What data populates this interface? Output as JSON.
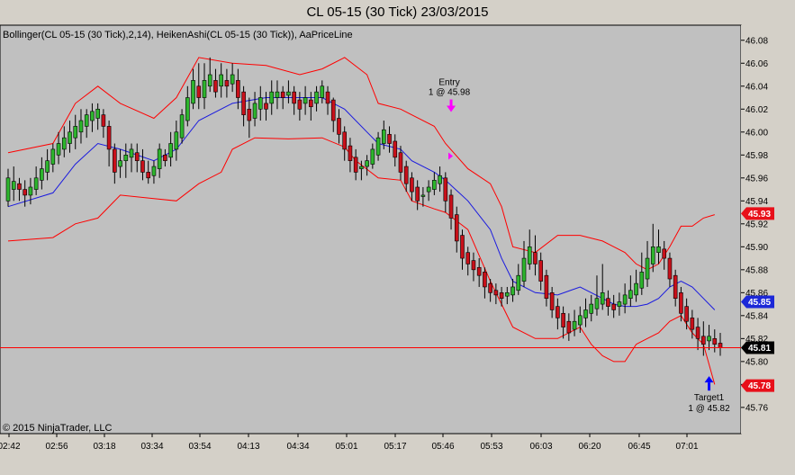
{
  "window": {
    "title": "CL 05-15 (30 Tick)  23/03/2015"
  },
  "indicator_label": "Bollinger(CL 05-15 (30 Tick),2,14), HeikenAshi(CL 05-15 (30 Tick)), AaPriceLine",
  "copyright": "© 2015 NinjaTrader, LLC",
  "colors": {
    "background": "#c0c0c0",
    "frame": "#d4d0c8",
    "bull": "#2db52d",
    "bear": "#c8101a",
    "wick": "#000000",
    "bollinger_band": "#ff0000",
    "bollinger_mid": "#1a1adf",
    "price_line": "#ff0000",
    "entry_arrow": "#ff00ff",
    "target_arrow": "#0000ff",
    "tag_red": "#e8101a",
    "tag_blue": "#1c28d8",
    "tag_black": "#000000"
  },
  "chart_data": {
    "type": "candlestick",
    "ylim": [
      45.745,
      46.09
    ],
    "y_ticks": [
      "46.08",
      "46.06",
      "46.04",
      "46.02",
      "46.00",
      "45.98",
      "45.96",
      "45.94",
      "45.92",
      "45.90",
      "45.88",
      "45.86",
      "45.84",
      "45.82",
      "45.80",
      "45.78",
      "45.76"
    ],
    "x_ticks": [
      "02:42",
      "02:56",
      "03:18",
      "03:34",
      "03:54",
      "04:13",
      "04:34",
      "05:01",
      "05:17",
      "05:46",
      "05:53",
      "06:03",
      "06:20",
      "06:45",
      "07:01"
    ],
    "candles": [
      [
        45.94,
        45.96,
        45.935,
        45.968,
        "u"
      ],
      [
        45.95,
        45.957,
        45.94,
        45.97,
        "u"
      ],
      [
        45.955,
        45.95,
        45.94,
        45.96,
        "d"
      ],
      [
        45.95,
        45.945,
        45.935,
        45.958,
        "d"
      ],
      [
        45.945,
        45.952,
        45.937,
        45.96,
        "u"
      ],
      [
        45.95,
        45.96,
        45.945,
        45.97,
        "u"
      ],
      [
        45.958,
        45.968,
        45.95,
        45.978,
        "u"
      ],
      [
        45.965,
        45.975,
        45.958,
        45.985,
        "u"
      ],
      [
        45.972,
        45.985,
        45.965,
        45.99,
        "u"
      ],
      [
        45.98,
        45.99,
        45.972,
        46.0,
        "u"
      ],
      [
        45.985,
        45.995,
        45.978,
        46.005,
        "u"
      ],
      [
        45.99,
        46.0,
        45.982,
        46.01,
        "u"
      ],
      [
        45.995,
        46.005,
        45.985,
        46.015,
        "u"
      ],
      [
        46.0,
        46.01,
        45.99,
        46.02,
        "u"
      ],
      [
        46.005,
        46.015,
        45.995,
        46.02,
        "u"
      ],
      [
        46.01,
        46.018,
        46.0,
        46.025,
        "u"
      ],
      [
        46.012,
        46.02,
        46.002,
        46.025,
        "u"
      ],
      [
        46.015,
        46.005,
        45.995,
        46.02,
        "d"
      ],
      [
        46.005,
        45.985,
        45.97,
        46.01,
        "d"
      ],
      [
        45.985,
        45.965,
        45.955,
        45.99,
        "d"
      ],
      [
        45.97,
        45.975,
        45.96,
        45.985,
        "u"
      ],
      [
        45.975,
        45.98,
        45.96,
        45.99,
        "u"
      ],
      [
        45.978,
        45.985,
        45.965,
        45.99,
        "u"
      ],
      [
        45.982,
        45.975,
        45.965,
        45.99,
        "d"
      ],
      [
        45.975,
        45.965,
        45.958,
        45.985,
        "d"
      ],
      [
        45.965,
        45.96,
        45.955,
        45.975,
        "d"
      ],
      [
        45.962,
        45.97,
        45.955,
        45.975,
        "u"
      ],
      [
        45.968,
        45.985,
        45.96,
        45.99,
        "u"
      ],
      [
        45.98,
        45.975,
        45.97,
        45.985,
        "d"
      ],
      [
        45.978,
        45.99,
        45.97,
        46.0,
        "u"
      ],
      [
        45.985,
        46.0,
        45.975,
        46.01,
        "u"
      ],
      [
        45.995,
        46.015,
        45.99,
        46.02,
        "u"
      ],
      [
        46.01,
        46.03,
        46.005,
        46.04,
        "u"
      ],
      [
        46.025,
        46.045,
        46.02,
        46.055,
        "u"
      ],
      [
        46.04,
        46.03,
        46.02,
        46.06,
        "d"
      ],
      [
        46.03,
        46.045,
        46.02,
        46.06,
        "u"
      ],
      [
        46.04,
        46.05,
        46.035,
        46.065,
        "u"
      ],
      [
        46.045,
        46.035,
        46.03,
        46.055,
        "d"
      ],
      [
        46.04,
        46.05,
        46.03,
        46.06,
        "u"
      ],
      [
        46.045,
        46.04,
        46.03,
        46.055,
        "d"
      ],
      [
        46.042,
        46.05,
        46.035,
        46.06,
        "u"
      ],
      [
        46.045,
        46.03,
        46.02,
        46.055,
        "d"
      ],
      [
        46.035,
        46.015,
        46.005,
        46.04,
        "d"
      ],
      [
        46.02,
        46.01,
        45.995,
        46.03,
        "d"
      ],
      [
        46.012,
        46.025,
        46.005,
        46.035,
        "u"
      ],
      [
        46.02,
        46.03,
        46.01,
        46.04,
        "u"
      ],
      [
        46.025,
        46.02,
        46.01,
        46.035,
        "d"
      ],
      [
        46.025,
        46.035,
        46.015,
        46.045,
        "u"
      ],
      [
        46.03,
        46.035,
        46.02,
        46.045,
        "u"
      ],
      [
        46.035,
        46.03,
        46.02,
        46.04,
        "d"
      ],
      [
        46.032,
        46.035,
        46.025,
        46.045,
        "u"
      ],
      [
        46.035,
        46.025,
        46.015,
        46.04,
        "d"
      ],
      [
        46.028,
        46.02,
        46.01,
        46.035,
        "d"
      ],
      [
        46.025,
        46.03,
        46.015,
        46.04,
        "u"
      ],
      [
        46.028,
        46.022,
        46.01,
        46.035,
        "d"
      ],
      [
        46.025,
        46.035,
        46.018,
        46.04,
        "u"
      ],
      [
        46.03,
        46.04,
        46.025,
        46.045,
        "u"
      ],
      [
        46.035,
        46.025,
        46.015,
        46.04,
        "d"
      ],
      [
        46.028,
        46.01,
        46.0,
        46.03,
        "d"
      ],
      [
        46.012,
        45.998,
        45.99,
        46.02,
        "d"
      ],
      [
        46.0,
        45.985,
        45.975,
        46.005,
        "d"
      ],
      [
        45.988,
        45.975,
        45.965,
        45.995,
        "d"
      ],
      [
        45.978,
        45.965,
        45.958,
        45.985,
        "d"
      ],
      [
        45.968,
        45.97,
        45.958,
        45.975,
        "u"
      ],
      [
        45.97,
        45.975,
        45.962,
        45.98,
        "u"
      ],
      [
        45.972,
        45.985,
        45.968,
        45.99,
        "u"
      ],
      [
        45.98,
        45.995,
        45.975,
        46.0,
        "u"
      ],
      [
        45.99,
        46.002,
        45.985,
        46.01,
        "u"
      ],
      [
        45.998,
        45.99,
        45.982,
        46.005,
        "d"
      ],
      [
        45.992,
        45.978,
        45.97,
        45.998,
        "d"
      ],
      [
        45.982,
        45.965,
        45.958,
        45.988,
        "d"
      ],
      [
        45.97,
        45.955,
        45.948,
        45.975,
        "d"
      ],
      [
        45.96,
        45.948,
        45.94,
        45.965,
        "d"
      ],
      [
        45.952,
        45.94,
        45.932,
        45.958,
        "d"
      ],
      [
        45.945,
        45.945,
        45.935,
        45.952,
        "u"
      ],
      [
        45.948,
        45.952,
        45.94,
        45.958,
        "u"
      ],
      [
        45.95,
        45.958,
        45.945,
        45.965,
        "u"
      ],
      [
        45.955,
        45.962,
        45.948,
        45.97,
        "u"
      ],
      [
        45.96,
        45.94,
        45.93,
        45.965,
        "d"
      ],
      [
        45.945,
        45.925,
        45.915,
        45.95,
        "d"
      ],
      [
        45.928,
        45.905,
        45.895,
        45.935,
        "d"
      ],
      [
        45.91,
        45.89,
        45.88,
        45.915,
        "d"
      ],
      [
        45.895,
        45.885,
        45.875,
        45.9,
        "d"
      ],
      [
        45.888,
        45.88,
        45.87,
        45.895,
        "d"
      ],
      [
        45.882,
        45.875,
        45.865,
        45.89,
        "d"
      ],
      [
        45.878,
        45.865,
        45.855,
        45.882,
        "d"
      ],
      [
        45.868,
        45.86,
        45.852,
        45.872,
        "d"
      ],
      [
        45.862,
        45.858,
        45.85,
        45.868,
        "d"
      ],
      [
        45.86,
        45.855,
        45.848,
        45.865,
        "d"
      ],
      [
        45.857,
        45.86,
        45.85,
        45.865,
        "u"
      ],
      [
        45.858,
        45.865,
        45.852,
        45.872,
        "u"
      ],
      [
        45.862,
        45.875,
        45.858,
        45.885,
        "u"
      ],
      [
        45.87,
        45.89,
        45.865,
        45.905,
        "u"
      ],
      [
        45.885,
        45.9,
        45.88,
        45.915,
        "u"
      ],
      [
        45.895,
        45.885,
        45.875,
        45.91,
        "d"
      ],
      [
        45.888,
        45.87,
        45.862,
        45.895,
        "d"
      ],
      [
        45.875,
        45.855,
        45.848,
        45.88,
        "d"
      ],
      [
        45.86,
        45.845,
        45.838,
        45.865,
        "d"
      ],
      [
        45.848,
        45.838,
        45.828,
        45.855,
        "d"
      ],
      [
        45.842,
        45.83,
        45.82,
        45.848,
        "d"
      ],
      [
        45.835,
        45.825,
        45.818,
        45.842,
        "d"
      ],
      [
        45.828,
        45.835,
        45.822,
        45.845,
        "u"
      ],
      [
        45.832,
        45.84,
        45.825,
        45.848,
        "u"
      ],
      [
        45.838,
        45.845,
        45.83,
        45.855,
        "u"
      ],
      [
        45.842,
        45.85,
        45.835,
        45.858,
        "u"
      ],
      [
        45.846,
        45.855,
        45.84,
        45.875,
        "u"
      ],
      [
        45.85,
        45.86,
        45.845,
        45.885,
        "u"
      ],
      [
        45.855,
        45.848,
        45.84,
        45.862,
        "d"
      ],
      [
        45.85,
        45.845,
        45.838,
        45.858,
        "d"
      ],
      [
        45.848,
        45.852,
        45.84,
        45.86,
        "u"
      ],
      [
        45.85,
        45.858,
        45.842,
        45.868,
        "u"
      ],
      [
        45.855,
        45.862,
        45.848,
        45.875,
        "u"
      ],
      [
        45.858,
        45.868,
        45.852,
        45.88,
        "u"
      ],
      [
        45.864,
        45.878,
        45.858,
        45.895,
        "u"
      ],
      [
        45.872,
        45.89,
        45.865,
        45.905,
        "u"
      ],
      [
        45.885,
        45.9,
        45.878,
        45.92,
        "u"
      ],
      [
        45.895,
        45.9,
        45.885,
        45.915,
        "u"
      ],
      [
        45.898,
        45.89,
        45.88,
        45.905,
        "d"
      ],
      [
        45.89,
        45.872,
        45.865,
        45.895,
        "d"
      ],
      [
        45.875,
        45.855,
        45.848,
        45.88,
        "d"
      ],
      [
        45.86,
        45.842,
        45.835,
        45.865,
        "d"
      ],
      [
        45.848,
        45.835,
        45.828,
        45.855,
        "d"
      ],
      [
        45.838,
        45.828,
        45.82,
        45.845,
        "d"
      ],
      [
        45.83,
        45.82,
        45.81,
        45.838,
        "d"
      ],
      [
        45.822,
        45.815,
        45.805,
        45.835,
        "d"
      ],
      [
        45.818,
        45.822,
        45.81,
        45.832,
        "u"
      ],
      [
        45.82,
        45.815,
        45.808,
        45.828,
        "d"
      ],
      [
        45.816,
        45.812,
        45.805,
        45.825,
        "d"
      ]
    ],
    "bollinger_upper": [
      [
        0,
        45.982
      ],
      [
        8,
        45.99
      ],
      [
        12,
        46.025
      ],
      [
        16,
        46.04
      ],
      [
        20,
        46.025
      ],
      [
        26,
        46.012
      ],
      [
        30,
        46.03
      ],
      [
        34,
        46.065
      ],
      [
        40,
        46.06
      ],
      [
        46,
        46.058
      ],
      [
        52,
        46.05
      ],
      [
        56,
        46.055
      ],
      [
        60,
        46.065
      ],
      [
        64,
        46.05
      ],
      [
        66,
        46.025
      ],
      [
        70,
        46.02
      ],
      [
        72,
        46.015
      ],
      [
        76,
        46.005
      ],
      [
        78,
        45.99
      ],
      [
        82,
        45.968
      ],
      [
        86,
        45.955
      ],
      [
        88,
        45.935
      ],
      [
        90,
        45.9
      ],
      [
        94,
        45.895
      ],
      [
        98,
        45.91
      ],
      [
        102,
        45.91
      ],
      [
        106,
        45.905
      ],
      [
        108,
        45.9
      ],
      [
        110,
        45.895
      ],
      [
        112,
        45.885
      ],
      [
        114,
        45.88
      ],
      [
        116,
        45.885
      ],
      [
        118,
        45.9
      ],
      [
        120,
        45.918
      ],
      [
        122,
        45.918
      ],
      [
        124,
        45.925
      ],
      [
        126,
        45.928
      ]
    ],
    "bollinger_lower": [
      [
        0,
        45.905
      ],
      [
        8,
        45.908
      ],
      [
        12,
        45.92
      ],
      [
        16,
        45.925
      ],
      [
        20,
        45.945
      ],
      [
        26,
        45.942
      ],
      [
        30,
        45.94
      ],
      [
        34,
        45.955
      ],
      [
        38,
        45.965
      ],
      [
        40,
        45.985
      ],
      [
        44,
        45.995
      ],
      [
        50,
        45.994
      ],
      [
        56,
        45.995
      ],
      [
        60,
        45.987
      ],
      [
        62,
        45.975
      ],
      [
        66,
        45.96
      ],
      [
        70,
        45.958
      ],
      [
        72,
        45.94
      ],
      [
        76,
        45.933
      ],
      [
        78,
        45.93
      ],
      [
        82,
        45.915
      ],
      [
        86,
        45.87
      ],
      [
        88,
        45.85
      ],
      [
        90,
        45.83
      ],
      [
        94,
        45.82
      ],
      [
        98,
        45.82
      ],
      [
        102,
        45.83
      ],
      [
        104,
        45.815
      ],
      [
        106,
        45.805
      ],
      [
        108,
        45.8
      ],
      [
        110,
        45.8
      ],
      [
        112,
        45.815
      ],
      [
        114,
        45.82
      ],
      [
        116,
        45.825
      ],
      [
        118,
        45.835
      ],
      [
        120,
        45.84
      ],
      [
        122,
        45.825
      ],
      [
        124,
        45.815
      ],
      [
        126,
        45.78
      ]
    ],
    "bollinger_mid": [
      [
        0,
        45.935
      ],
      [
        8,
        45.947
      ],
      [
        12,
        45.972
      ],
      [
        16,
        45.99
      ],
      [
        20,
        45.985
      ],
      [
        26,
        45.975
      ],
      [
        30,
        45.985
      ],
      [
        34,
        46.01
      ],
      [
        40,
        46.025
      ],
      [
        46,
        46.03
      ],
      [
        52,
        46.03
      ],
      [
        56,
        46.03
      ],
      [
        60,
        46.02
      ],
      [
        64,
        46.0
      ],
      [
        66,
        45.99
      ],
      [
        70,
        45.985
      ],
      [
        72,
        45.975
      ],
      [
        76,
        45.965
      ],
      [
        78,
        45.958
      ],
      [
        82,
        45.94
      ],
      [
        86,
        45.915
      ],
      [
        88,
        45.89
      ],
      [
        90,
        45.87
      ],
      [
        94,
        45.86
      ],
      [
        98,
        45.858
      ],
      [
        102,
        45.865
      ],
      [
        106,
        45.855
      ],
      [
        108,
        45.85
      ],
      [
        110,
        45.848
      ],
      [
        112,
        45.848
      ],
      [
        114,
        45.85
      ],
      [
        116,
        45.855
      ],
      [
        118,
        45.865
      ],
      [
        120,
        45.87
      ],
      [
        122,
        45.865
      ],
      [
        124,
        45.855
      ],
      [
        126,
        45.845
      ]
    ],
    "price_line": 45.812,
    "price_tags": [
      {
        "label": "45.93",
        "value": 45.929,
        "style": "red"
      },
      {
        "label": "45.85",
        "value": 45.852,
        "style": "blue"
      },
      {
        "label": "45.81",
        "value": 45.812,
        "style": "black"
      },
      {
        "label": "45.78",
        "value": 45.779,
        "style": "red"
      }
    ],
    "annotations": {
      "entry": {
        "title": "Entry",
        "detail": "1 @ 45.98",
        "bar": 79,
        "price": 46.019
      },
      "target": {
        "title": "Target1",
        "detail": "1 @ 45.82",
        "bar": 125,
        "price": 45.788
      }
    }
  }
}
